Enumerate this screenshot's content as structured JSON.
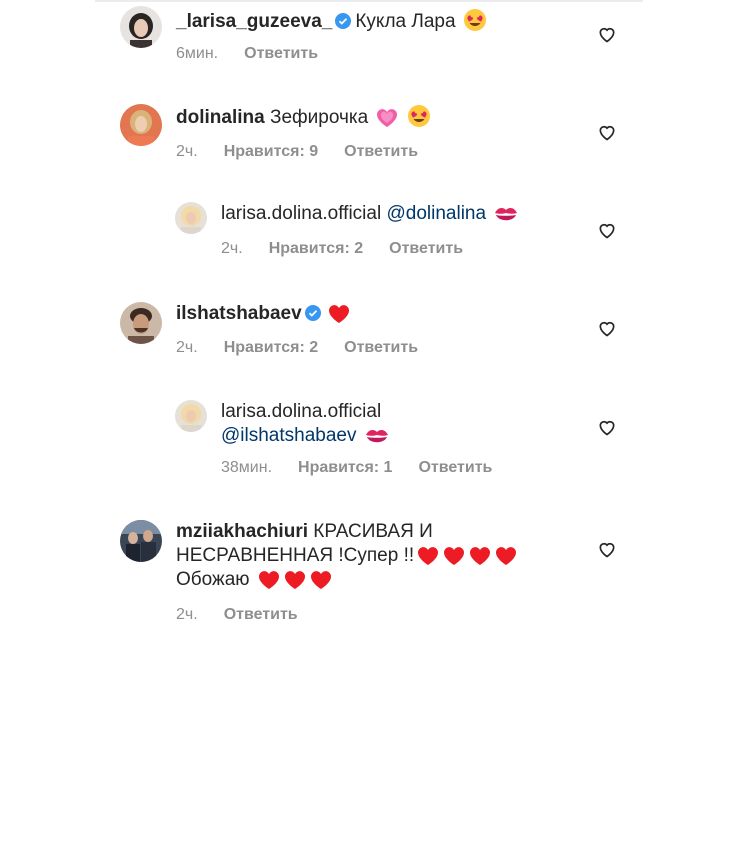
{
  "comments": [
    {
      "username": "_larisa_guzeeva_",
      "text": "Кукла Лара",
      "time": "6мин.",
      "reply_label": "Ответить"
    },
    {
      "username": "dolinalina",
      "text": "Зефирочка",
      "time": "2ч.",
      "likes": "Нравится: 9",
      "reply_label": "Ответить"
    },
    {
      "username": "larisa.dolina.official",
      "mention": "@dolinalina",
      "time": "2ч.",
      "likes": "Нравится: 2",
      "reply_label": "Ответить"
    },
    {
      "username": "ilshatshabaev",
      "time": "2ч.",
      "likes": "Нравится: 2",
      "reply_label": "Ответить"
    },
    {
      "username": "larisa.dolina.official",
      "mention": "@ilshatshabaev",
      "time": "38мин.",
      "likes": "Нравится: 1",
      "reply_label": "Ответить"
    },
    {
      "username": "mziiakhachiuri",
      "text_line1": "КРАСИВАЯ И",
      "text_line2": "НЕСРАВНЕННАЯ !Супер !!",
      "text_line3": "Обожаю",
      "time": "2ч.",
      "reply_label": "Ответить"
    }
  ],
  "colors": {
    "verified": "#3897f0",
    "heart_red": "#ed1c24",
    "meta_gray": "#8e8e8e",
    "mention": "#00376b"
  },
  "icons": {
    "like": "heart-outline-icon",
    "verified": "verified-badge-icon"
  }
}
